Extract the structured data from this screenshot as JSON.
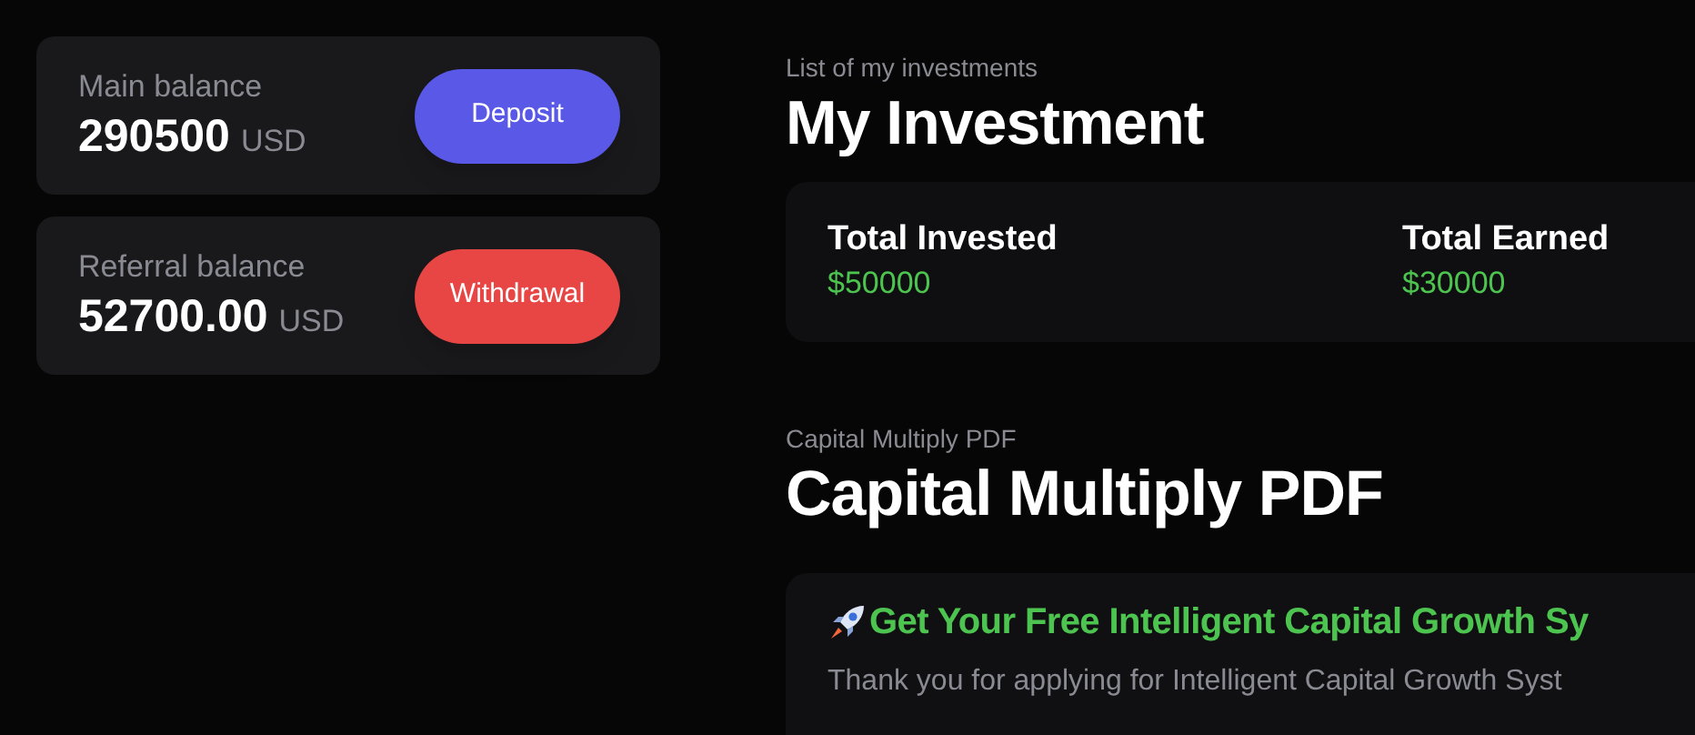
{
  "balances": [
    {
      "label": "Main balance",
      "amount": "290500",
      "currency": "USD",
      "action": {
        "label": "Deposit",
        "kind": "deposit"
      }
    },
    {
      "label": "Referral balance",
      "amount": "52700.00",
      "currency": "USD",
      "action": {
        "label": "Withdrawal",
        "kind": "withdrawal"
      }
    }
  ],
  "investments": {
    "subtitle": "List of my investments",
    "title": "My Investment",
    "stats": [
      {
        "label": "Total Invested",
        "value": "$50000"
      },
      {
        "label": "Total Earned",
        "value": "$30000"
      }
    ]
  },
  "pdf": {
    "subtitle": "Capital Multiply PDF",
    "title": "Capital Multiply PDF",
    "card": {
      "heading": "Get Your Free Intelligent Capital Growth Sy",
      "text": "Thank you for applying for Intelligent Capital Growth Syst"
    }
  }
}
